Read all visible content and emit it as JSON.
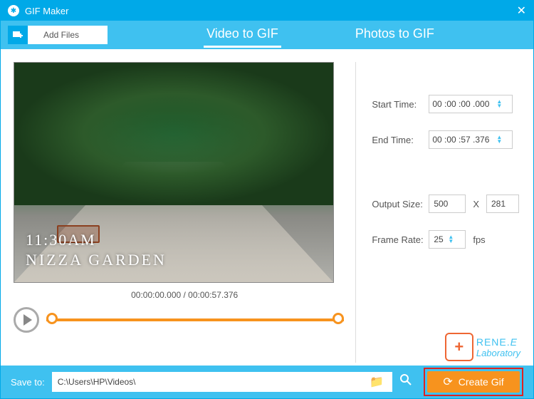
{
  "window": {
    "title": "GIF Maker"
  },
  "toolbar": {
    "addFiles": "Add Files"
  },
  "tabs": {
    "videoToGif": "Video to GIF",
    "photosToGif": "Photos to GIF"
  },
  "preview": {
    "overlayTime": "11:30AM",
    "overlayTitle": "NIZZA GARDEN",
    "timecodes": "00:00:00.000 / 00:00:57.376"
  },
  "settings": {
    "startTimeLabel": "Start Time:",
    "startTime": "00 :00 :00 .000",
    "endTimeLabel": "End Time:",
    "endTime": "00 :00 :57 .376",
    "outputSizeLabel": "Output Size:",
    "width": "500",
    "x": "X",
    "height": "281",
    "frameRateLabel": "Frame Rate:",
    "frameRate": "25",
    "fps": "fps"
  },
  "brand": {
    "line1a": "RENE.",
    "line1e": "E",
    "line2": "Laboratory",
    "badge": "+"
  },
  "footer": {
    "saveToLabel": "Save to:",
    "path": "C:\\Users\\HP\\Videos\\",
    "createGif": "Create Gif"
  }
}
